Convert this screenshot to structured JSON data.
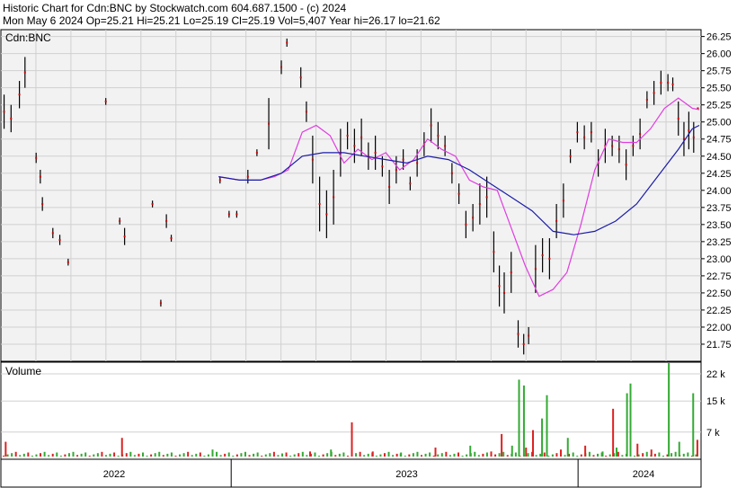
{
  "header": {
    "line1": "Historic Chart for Cdn:BNC by Stockwatch.com 604.687.1500 - (c) 2024",
    "line2": "Mon May  6 2024   Op=25.21   Hi=25.21   Lo=25.19   Cl=25.19   Vol=5,407   Year hi=26.17   lo=21.62"
  },
  "colors": {
    "background": "#ffffff",
    "plot_background": "#f2f2f2",
    "grid": "#d0d0d0",
    "price_bar_dark": "#000000",
    "price_bar_red": "#cc0000",
    "ma_short": "#e03ce0",
    "ma_long": "#1c1caa",
    "volume_up": "#33aa33",
    "volume_down": "#dd2222"
  },
  "chart_data": [
    {
      "type": "line",
      "panel": "price",
      "title": "Cdn:BNC",
      "ylim": [
        21.5,
        26.35
      ],
      "yticks": [
        "26.25",
        "26.00",
        "25.75",
        "25.50",
        "25.25",
        "25.00",
        "24.75",
        "24.50",
        "24.25",
        "24.00",
        "23.75",
        "23.50",
        "23.25",
        "23.00",
        "22.75",
        "22.50",
        "22.25",
        "22.00",
        "21.75"
      ],
      "grid": true,
      "price_bars": [
        {
          "x": 0.002,
          "low": 24.9,
          "high": 25.4
        },
        {
          "x": 0.012,
          "low": 24.85,
          "high": 25.25
        },
        {
          "x": 0.024,
          "low": 25.2,
          "high": 25.6
        },
        {
          "x": 0.032,
          "low": 25.5,
          "high": 25.95
        },
        {
          "x": 0.048,
          "low": 24.4,
          "high": 24.55
        },
        {
          "x": 0.054,
          "low": 24.1,
          "high": 24.3
        },
        {
          "x": 0.057,
          "low": 23.7,
          "high": 23.9
        },
        {
          "x": 0.072,
          "low": 23.3,
          "high": 23.45
        },
        {
          "x": 0.082,
          "low": 23.2,
          "high": 23.35
        },
        {
          "x": 0.094,
          "low": 22.9,
          "high": 23.0
        },
        {
          "x": 0.148,
          "low": 25.25,
          "high": 25.35
        },
        {
          "x": 0.168,
          "low": 23.5,
          "high": 23.6
        },
        {
          "x": 0.175,
          "low": 23.2,
          "high": 23.45
        },
        {
          "x": 0.215,
          "low": 23.75,
          "high": 23.85
        },
        {
          "x": 0.227,
          "low": 22.3,
          "high": 22.4
        },
        {
          "x": 0.235,
          "low": 23.45,
          "high": 23.65
        },
        {
          "x": 0.242,
          "low": 23.25,
          "high": 23.35
        },
        {
          "x": 0.312,
          "low": 24.1,
          "high": 24.2
        },
        {
          "x": 0.325,
          "low": 23.6,
          "high": 23.7
        },
        {
          "x": 0.336,
          "low": 23.6,
          "high": 23.7
        },
        {
          "x": 0.352,
          "low": 24.1,
          "high": 24.3
        },
        {
          "x": 0.365,
          "low": 24.5,
          "high": 24.6
        },
        {
          "x": 0.382,
          "low": 24.6,
          "high": 25.35
        },
        {
          "x": 0.4,
          "low": 25.7,
          "high": 25.9
        },
        {
          "x": 0.408,
          "low": 26.1,
          "high": 26.22
        },
        {
          "x": 0.428,
          "low": 25.5,
          "high": 25.8
        },
        {
          "x": 0.436,
          "low": 25.0,
          "high": 25.3
        },
        {
          "x": 0.445,
          "low": 24.1,
          "high": 24.8
        },
        {
          "x": 0.455,
          "low": 23.4,
          "high": 24.2
        },
        {
          "x": 0.465,
          "low": 23.3,
          "high": 24.0
        },
        {
          "x": 0.475,
          "low": 23.5,
          "high": 24.3
        },
        {
          "x": 0.485,
          "low": 24.2,
          "high": 24.9
        },
        {
          "x": 0.495,
          "low": 24.6,
          "high": 25.0
        },
        {
          "x": 0.505,
          "low": 24.4,
          "high": 24.9
        },
        {
          "x": 0.515,
          "low": 24.5,
          "high": 25.05
        },
        {
          "x": 0.525,
          "low": 24.3,
          "high": 24.7
        },
        {
          "x": 0.535,
          "low": 24.3,
          "high": 24.8
        },
        {
          "x": 0.545,
          "low": 24.2,
          "high": 24.5
        },
        {
          "x": 0.555,
          "low": 23.8,
          "high": 24.3
        },
        {
          "x": 0.565,
          "low": 24.1,
          "high": 24.5
        },
        {
          "x": 0.575,
          "low": 24.3,
          "high": 24.6
        },
        {
          "x": 0.585,
          "low": 24.0,
          "high": 24.2
        },
        {
          "x": 0.595,
          "low": 24.2,
          "high": 24.6
        },
        {
          "x": 0.605,
          "low": 24.5,
          "high": 24.85
        },
        {
          "x": 0.615,
          "low": 24.7,
          "high": 25.2
        },
        {
          "x": 0.625,
          "low": 24.6,
          "high": 25.0
        },
        {
          "x": 0.635,
          "low": 24.5,
          "high": 24.8
        },
        {
          "x": 0.645,
          "low": 24.1,
          "high": 24.4
        },
        {
          "x": 0.655,
          "low": 23.8,
          "high": 24.1
        },
        {
          "x": 0.665,
          "low": 23.3,
          "high": 23.7
        },
        {
          "x": 0.675,
          "low": 23.4,
          "high": 23.8
        },
        {
          "x": 0.685,
          "low": 23.5,
          "high": 24.1
        },
        {
          "x": 0.695,
          "low": 23.6,
          "high": 24.2
        },
        {
          "x": 0.705,
          "low": 22.8,
          "high": 23.4
        },
        {
          "x": 0.713,
          "low": 22.3,
          "high": 22.9
        },
        {
          "x": 0.72,
          "low": 22.2,
          "high": 22.8
        },
        {
          "x": 0.73,
          "low": 22.5,
          "high": 23.1
        },
        {
          "x": 0.74,
          "low": 21.7,
          "high": 22.1
        },
        {
          "x": 0.748,
          "low": 21.6,
          "high": 21.9
        },
        {
          "x": 0.755,
          "low": 21.75,
          "high": 22.0
        },
        {
          "x": 0.765,
          "low": 22.5,
          "high": 23.2
        },
        {
          "x": 0.775,
          "low": 22.8,
          "high": 23.3
        },
        {
          "x": 0.785,
          "low": 22.7,
          "high": 23.3
        },
        {
          "x": 0.795,
          "low": 23.3,
          "high": 23.8
        },
        {
          "x": 0.805,
          "low": 23.6,
          "high": 24.1
        },
        {
          "x": 0.815,
          "low": 24.4,
          "high": 24.6
        },
        {
          "x": 0.825,
          "low": 24.7,
          "high": 25.0
        },
        {
          "x": 0.835,
          "low": 24.6,
          "high": 24.95
        },
        {
          "x": 0.845,
          "low": 24.7,
          "high": 25.0
        },
        {
          "x": 0.855,
          "low": 24.2,
          "high": 24.6
        },
        {
          "x": 0.865,
          "low": 24.4,
          "high": 24.9
        },
        {
          "x": 0.875,
          "low": 24.5,
          "high": 24.8
        },
        {
          "x": 0.885,
          "low": 24.4,
          "high": 24.8
        },
        {
          "x": 0.895,
          "low": 24.15,
          "high": 24.6
        },
        {
          "x": 0.905,
          "low": 24.5,
          "high": 24.8
        },
        {
          "x": 0.915,
          "low": 24.6,
          "high": 25.05
        },
        {
          "x": 0.925,
          "low": 25.2,
          "high": 25.45
        },
        {
          "x": 0.935,
          "low": 25.25,
          "high": 25.6
        },
        {
          "x": 0.945,
          "low": 25.4,
          "high": 25.75
        },
        {
          "x": 0.955,
          "low": 25.45,
          "high": 25.7
        },
        {
          "x": 0.962,
          "low": 25.45,
          "high": 25.65
        },
        {
          "x": 0.97,
          "low": 24.8,
          "high": 25.3
        },
        {
          "x": 0.978,
          "low": 24.5,
          "high": 25.0
        },
        {
          "x": 0.985,
          "low": 24.6,
          "high": 25.15
        },
        {
          "x": 0.992,
          "low": 24.55,
          "high": 25.0
        },
        {
          "x": 0.998,
          "low": 25.19,
          "high": 25.21
        }
      ],
      "series": [
        {
          "values_x": [
            0.31,
            0.34,
            0.37,
            0.39,
            0.41,
            0.43,
            0.45,
            0.47,
            0.49,
            0.51,
            0.53,
            0.55,
            0.57,
            0.59,
            0.61,
            0.63,
            0.65,
            0.67,
            0.69,
            0.71,
            0.73,
            0.75,
            0.77,
            0.79,
            0.81,
            0.83,
            0.85,
            0.87,
            0.89,
            0.91,
            0.93,
            0.95,
            0.97,
            0.99,
            1.0
          ],
          "values": [
            24.2,
            24.15,
            24.15,
            24.2,
            24.3,
            24.85,
            24.95,
            24.8,
            24.4,
            24.6,
            24.45,
            24.55,
            24.3,
            24.45,
            24.75,
            24.6,
            24.5,
            24.15,
            24.05,
            24.0,
            23.45,
            22.9,
            22.45,
            22.55,
            22.8,
            23.5,
            24.3,
            24.75,
            24.7,
            24.7,
            24.9,
            25.2,
            25.35,
            25.2,
            25.18
          ]
        },
        {
          "values_x": [
            0.31,
            0.34,
            0.37,
            0.4,
            0.43,
            0.46,
            0.49,
            0.52,
            0.55,
            0.58,
            0.61,
            0.64,
            0.67,
            0.7,
            0.73,
            0.76,
            0.79,
            0.82,
            0.85,
            0.88,
            0.91,
            0.94,
            0.97,
            0.99,
            1.0
          ],
          "values": [
            24.2,
            24.15,
            24.15,
            24.25,
            24.5,
            24.55,
            24.55,
            24.5,
            24.45,
            24.4,
            24.5,
            24.45,
            24.3,
            24.1,
            23.9,
            23.7,
            23.4,
            23.35,
            23.4,
            23.55,
            23.8,
            24.2,
            24.6,
            24.9,
            24.95
          ]
        }
      ]
    },
    {
      "type": "bar",
      "panel": "volume",
      "title": "Volume",
      "ylim": [
        0,
        25
      ],
      "yticks": [
        "22 k",
        "15 k",
        "7 k"
      ],
      "bars": [
        {
          "x": 0.003,
          "v": 4.5,
          "up": false
        },
        {
          "x": 0.17,
          "v": 5.5,
          "up": false
        },
        {
          "x": 0.3,
          "v": 2.5,
          "up": true
        },
        {
          "x": 0.4,
          "v": 1.5,
          "up": true
        },
        {
          "x": 0.44,
          "v": 2.0,
          "up": false
        },
        {
          "x": 0.47,
          "v": 2.5,
          "up": true
        },
        {
          "x": 0.5,
          "v": 9.5,
          "up": false
        },
        {
          "x": 0.53,
          "v": 2.0,
          "up": false
        },
        {
          "x": 0.57,
          "v": 1.5,
          "up": true
        },
        {
          "x": 0.62,
          "v": 3.0,
          "up": false
        },
        {
          "x": 0.67,
          "v": 3.5,
          "up": true
        },
        {
          "x": 0.7,
          "v": 2.0,
          "up": false
        },
        {
          "x": 0.715,
          "v": 6.5,
          "up": false
        },
        {
          "x": 0.73,
          "v": 3.5,
          "up": true
        },
        {
          "x": 0.74,
          "v": 20.5,
          "up": true
        },
        {
          "x": 0.747,
          "v": 19.0,
          "up": true
        },
        {
          "x": 0.75,
          "v": 3.0,
          "up": false
        },
        {
          "x": 0.76,
          "v": 7.5,
          "up": false
        },
        {
          "x": 0.773,
          "v": 10.5,
          "up": true
        },
        {
          "x": 0.78,
          "v": 16.5,
          "up": true
        },
        {
          "x": 0.8,
          "v": 2.5,
          "up": false
        },
        {
          "x": 0.81,
          "v": 5.5,
          "up": true
        },
        {
          "x": 0.835,
          "v": 3.5,
          "up": false
        },
        {
          "x": 0.86,
          "v": 2.0,
          "up": true
        },
        {
          "x": 0.875,
          "v": 13.0,
          "up": false
        },
        {
          "x": 0.88,
          "v": 3.0,
          "up": true
        },
        {
          "x": 0.895,
          "v": 17.0,
          "up": true
        },
        {
          "x": 0.9,
          "v": 19.5,
          "up": true
        },
        {
          "x": 0.91,
          "v": 4.0,
          "up": false
        },
        {
          "x": 0.93,
          "v": 2.5,
          "up": false
        },
        {
          "x": 0.955,
          "v": 27.0,
          "up": true
        },
        {
          "x": 0.97,
          "v": 4.5,
          "up": true
        },
        {
          "x": 0.99,
          "v": 17.0,
          "up": true
        },
        {
          "x": 0.996,
          "v": 5.0,
          "up": false
        }
      ]
    },
    {
      "type": "axis",
      "panel": "time",
      "year_labels": [
        {
          "label": "2022",
          "x": 0.16
        },
        {
          "label": "2023",
          "x": 0.58
        },
        {
          "label": "2024",
          "x": 0.92
        }
      ],
      "year_boundaries": [
        0.328,
        0.826
      ]
    }
  ]
}
